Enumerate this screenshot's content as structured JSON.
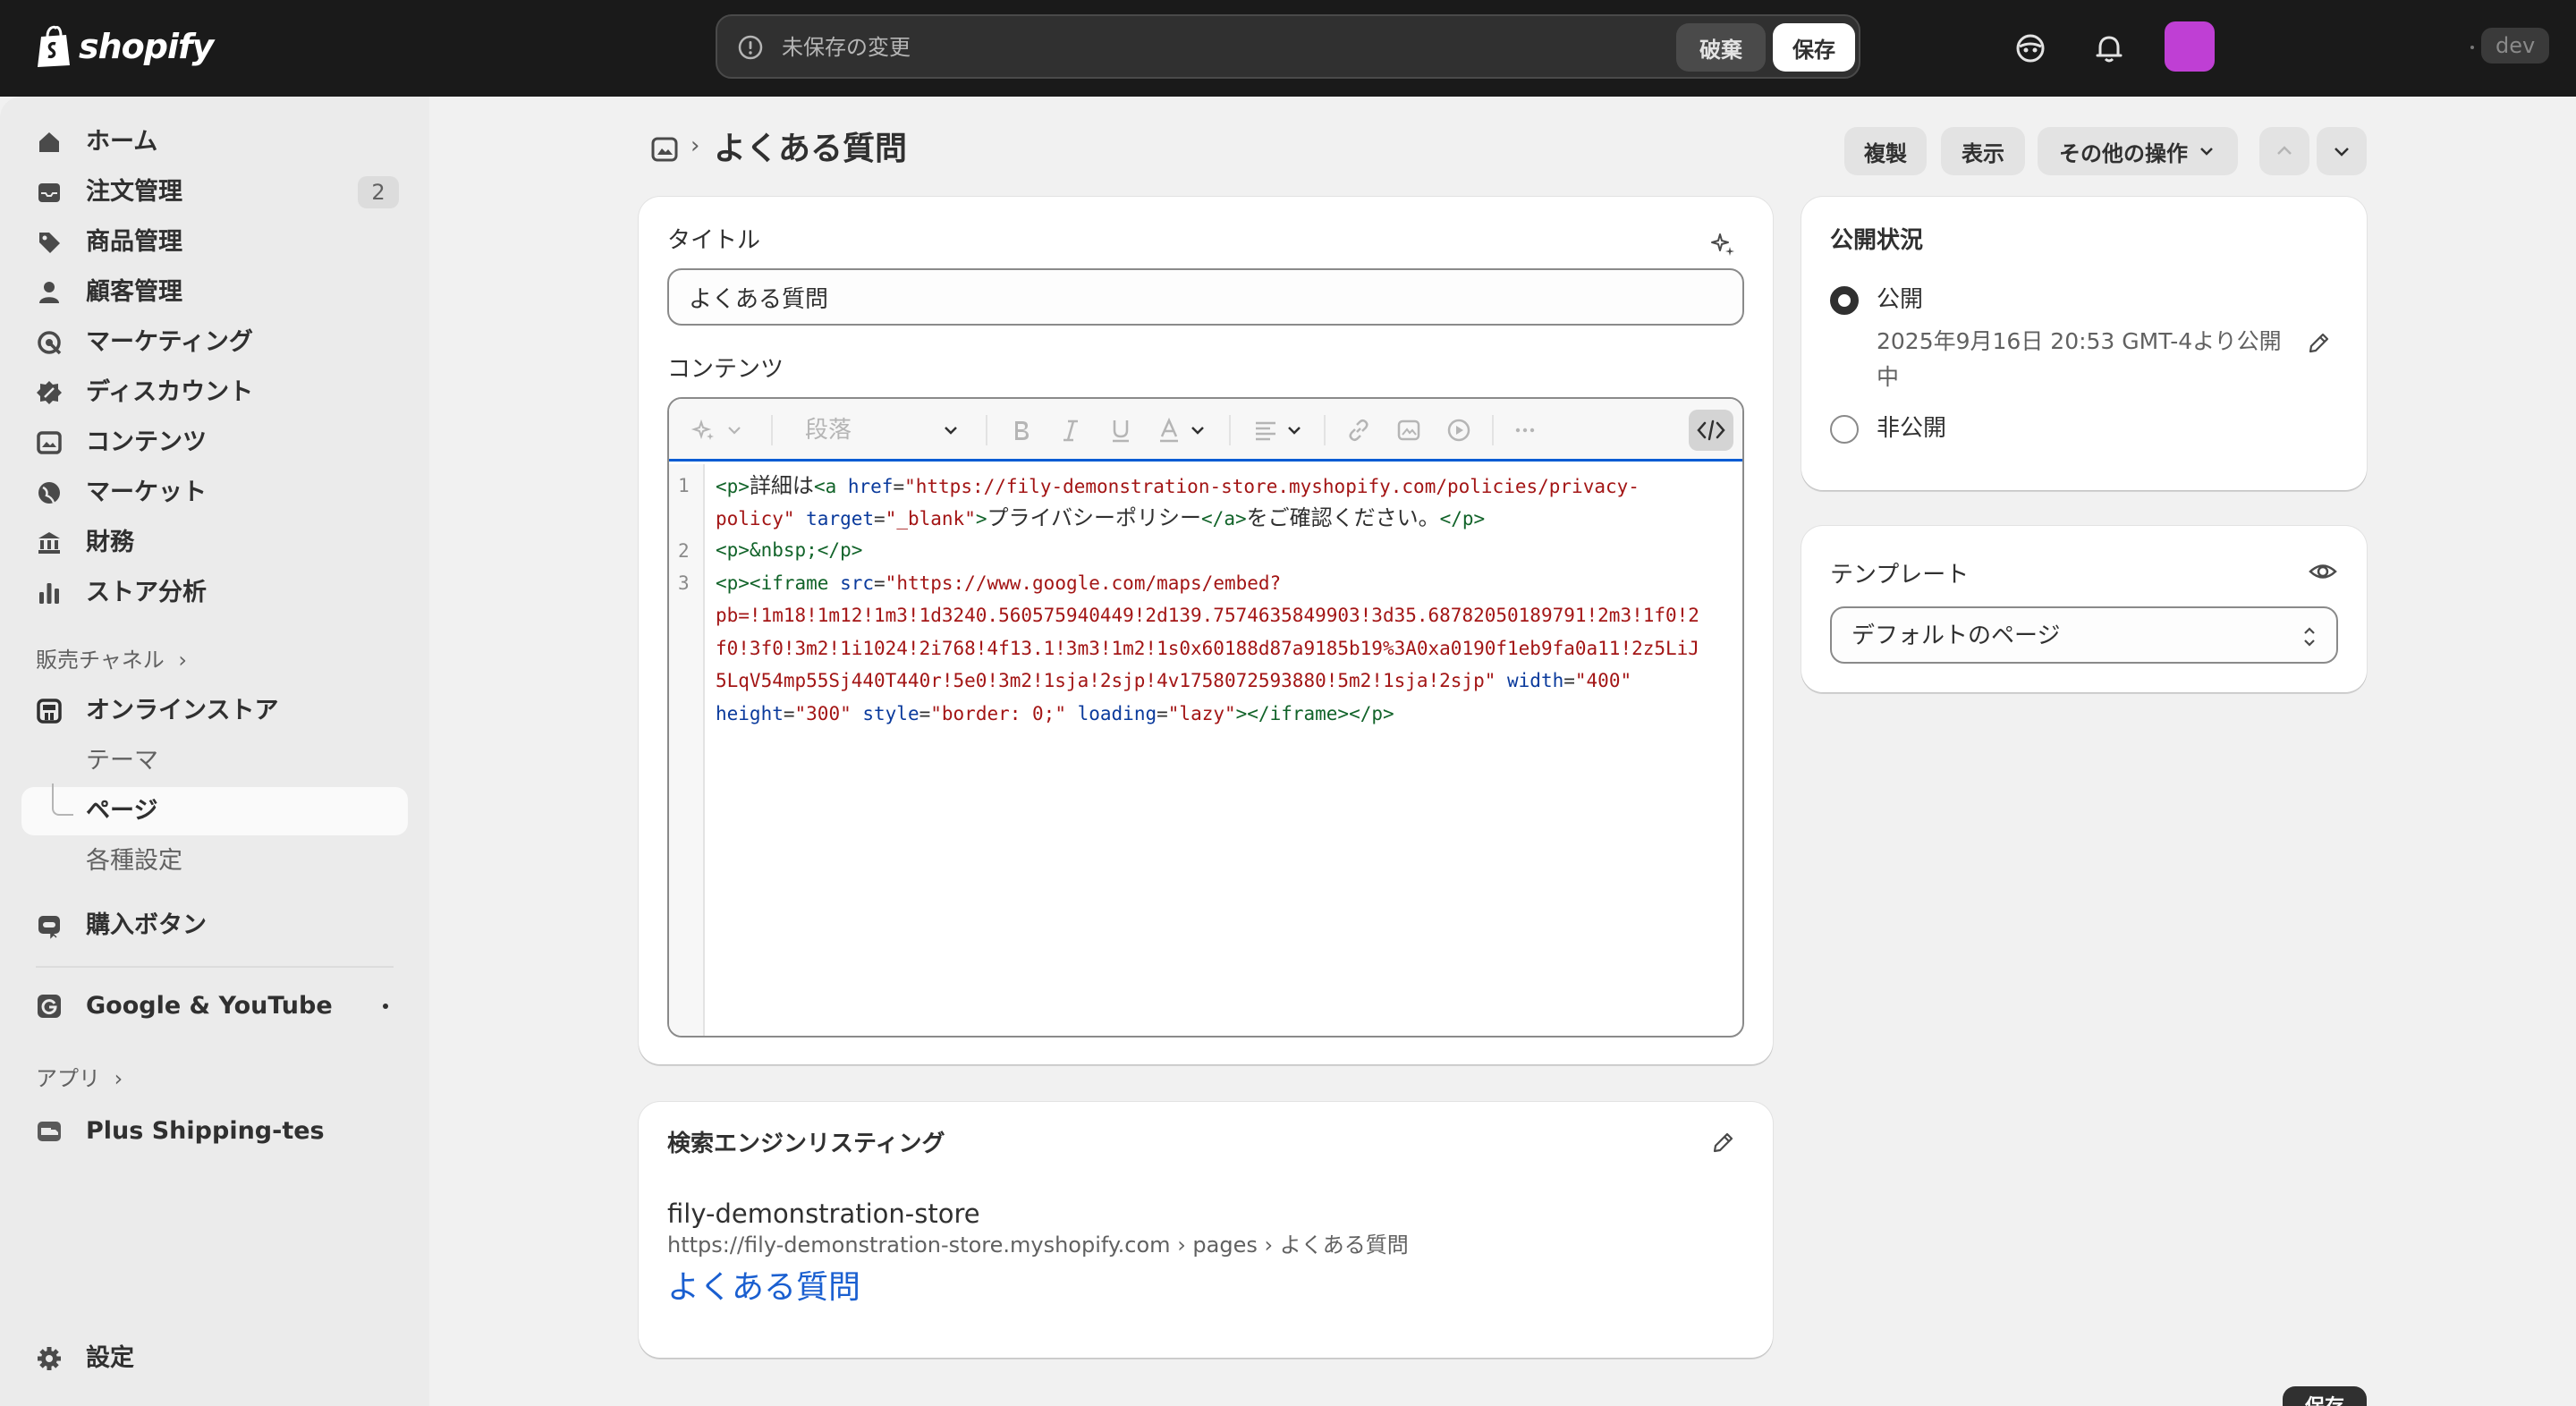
{
  "topbar": {
    "logo_text": "shopify",
    "unsaved_text": "未保存の変更",
    "discard_label": "破棄",
    "save_label": "保存",
    "dev_label": "dev",
    "avatar_color": "#bf3fd4"
  },
  "sidebar": {
    "items": [
      {
        "label": "ホーム",
        "icon": "home-icon"
      },
      {
        "label": "注文管理",
        "icon": "inbox-icon",
        "badge": "2"
      },
      {
        "label": "商品管理",
        "icon": "tag-icon"
      },
      {
        "label": "顧客管理",
        "icon": "person-icon"
      },
      {
        "label": "マーケティング",
        "icon": "target-icon"
      },
      {
        "label": "ディスカウント",
        "icon": "discount-icon"
      },
      {
        "label": "コンテンツ",
        "icon": "content-icon"
      },
      {
        "label": "マーケット",
        "icon": "globe-icon"
      },
      {
        "label": "財務",
        "icon": "bank-icon"
      },
      {
        "label": "ストア分析",
        "icon": "chart-bar-icon"
      }
    ],
    "sales_channels_label": "販売チャネル",
    "online_store": {
      "label": "オンラインストア",
      "sub": [
        "テーマ",
        "ページ",
        "各種設定"
      ]
    },
    "buy_button_label": "購入ボタン",
    "google_label": "Google & YouTube",
    "apps_label": "アプリ",
    "app_item_label": "Plus Shipping-tes",
    "settings_label": "設定"
  },
  "header": {
    "title": "よくある質問",
    "duplicate_label": "複製",
    "view_label": "表示",
    "more_actions_label": "その他の操作"
  },
  "content_card": {
    "title_label": "タイトル",
    "title_value": "よくある質問",
    "content_label": "コンテンツ",
    "format_select": "段落",
    "line_numbers": [
      "1",
      "2",
      "3"
    ]
  },
  "code": {
    "l1_t1": "<p>",
    "l1_j1": "詳細は",
    "l1_t2": "<a ",
    "l1_a1": "href",
    "l1_eq1": "=",
    "l1_v1": "\"https://fily-demonstration-store.myshopify.com/policies/privacy-",
    "l1b_v1": "policy\"",
    "l1b_a2": " target",
    "l1b_eq2": "=",
    "l1b_v2": "\"_blank\"",
    "l1b_t3": ">",
    "l1b_j2": "プライバシーポリシー",
    "l1b_t4": "</a>",
    "l1b_j3": "をご確認ください。",
    "l1b_t5": "</p>",
    "l2": "<p>&nbsp;</p>",
    "l3_t1": "<p><iframe ",
    "l3_a1": "src",
    "l3_eq1": "=",
    "l3_v1": "\"https://www.google.com/maps/embed?",
    "l3b": "pb=!1m18!1m12!1m3!1d3240.560575940449!2d139.7574635849903!3d35.68782050189791!2m3!1f0!2",
    "l3c": "f0!3f0!3m2!1i1024!2i768!4f13.1!3m3!1m2!1s0x60188d87a9185b19%3A0xa0190f1eb9fa0a11!2z5LiJ",
    "l3d_v": "5LqV54mp55Sj440T440r!5e0!3m2!1sja!2sjp!4v1758072593880!5m2!1sja!2sjp\"",
    "l3d_a": " width",
    "l3d_eq": "=",
    "l3d_v2": "\"400\"",
    "l3e_a1": "height",
    "l3e_eq1": "=",
    "l3e_v1": "\"300\"",
    "l3e_a2": " style",
    "l3e_eq2": "=",
    "l3e_v2": "\"border: 0;\"",
    "l3e_a3": " loading",
    "l3e_eq3": "=",
    "l3e_v3": "\"lazy\"",
    "l3e_t": "></iframe></p>"
  },
  "seo_card": {
    "title": "検索エンジンリスティング",
    "store_name": "fily-demonstration-store",
    "url": "https://fily-demonstration-store.myshopify.com › pages › よくある質問",
    "page_title": "よくある質問"
  },
  "visibility_card": {
    "title": "公開状況",
    "public_label": "公開",
    "public_desc": "2025年9月16日 20:53 GMT-4より公開中",
    "private_label": "非公開",
    "selected": "公開"
  },
  "template_card": {
    "title": "テンプレート",
    "selected_template": "デフォルトのページ"
  },
  "footer": {
    "save_label": "保存"
  }
}
